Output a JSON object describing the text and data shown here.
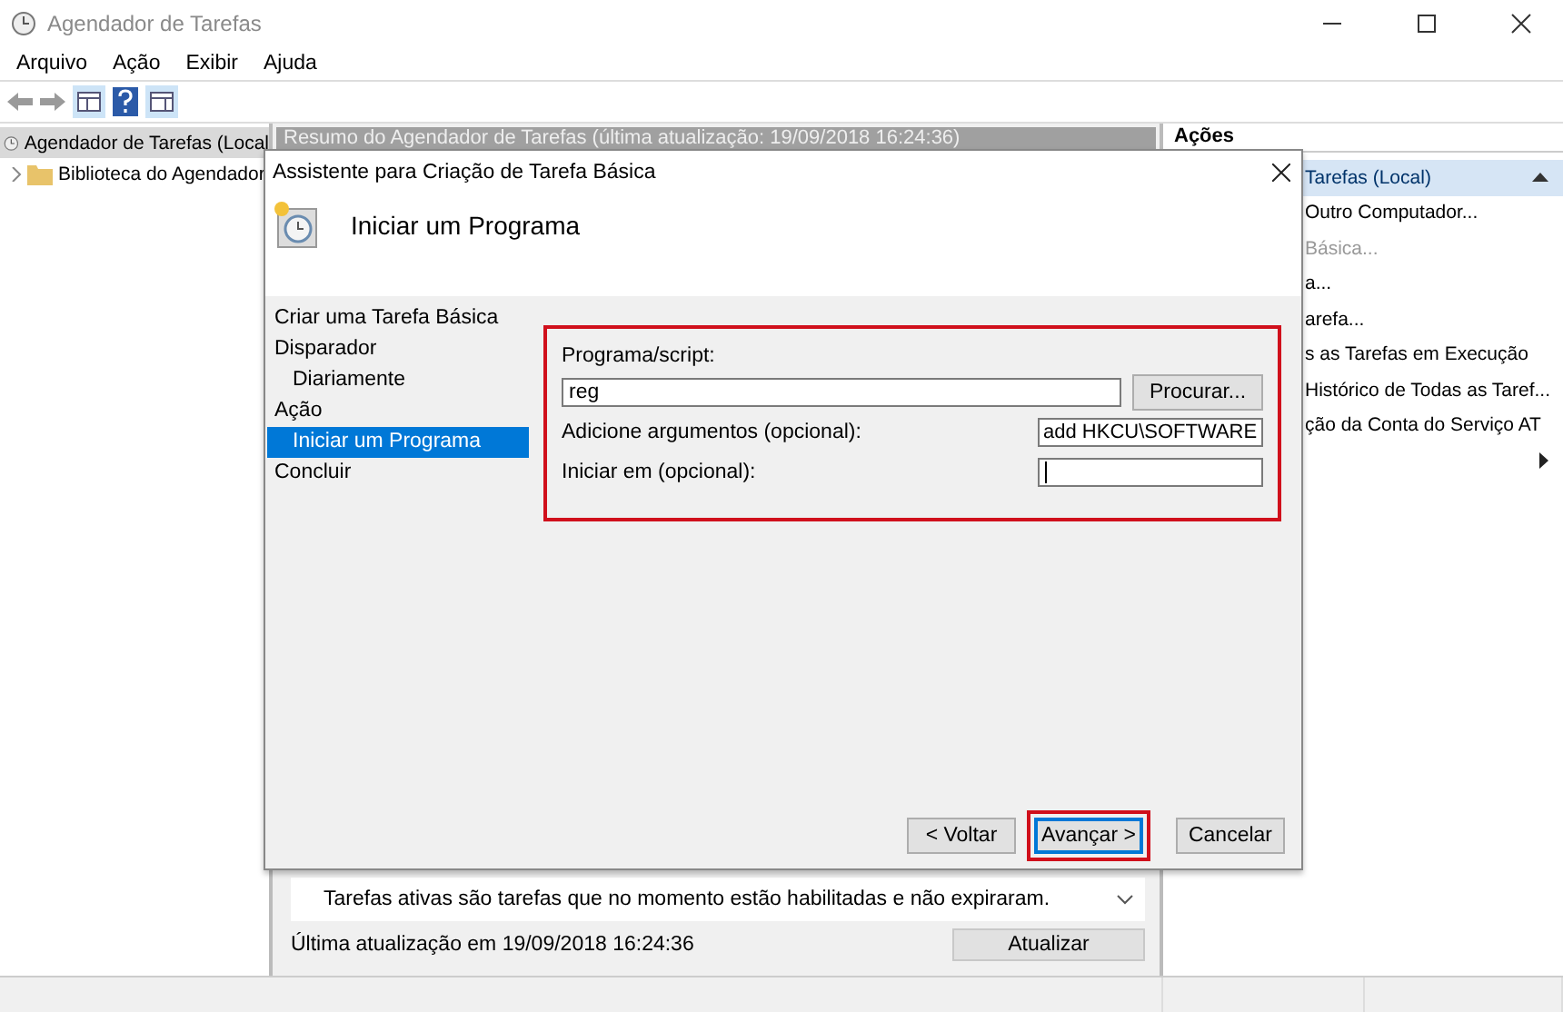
{
  "window": {
    "title": "Agendador de Tarefas"
  },
  "menu": [
    "Arquivo",
    "Ação",
    "Exibir",
    "Ajuda"
  ],
  "tree": [
    {
      "label": "Agendador de Tarefas (Local",
      "selected": true,
      "children": [
        {
          "label": "Biblioteca do Agendador",
          "selected": false,
          "expanded": false
        }
      ]
    }
  ],
  "summary": {
    "header": "Resumo do Agendador de Tarefas (última atualização: 19/09/2018 16:24:36)",
    "active_note": "Tarefas ativas são tarefas que no momento estão habilitadas e não expiraram.",
    "last_update": "Última atualização em 19/09/2018 16:24:36",
    "refresh_button": "Atualizar"
  },
  "actions": {
    "header": "Ações",
    "items": [
      {
        "label": "Tarefas (Local)",
        "kind": "group"
      },
      {
        "label": "Outro Computador...",
        "kind": "item",
        "disabled": false
      },
      {
        "label": "Básica...",
        "kind": "item",
        "disabled": true
      },
      {
        "label": "a...",
        "kind": "item",
        "disabled": false
      },
      {
        "label": "arefa...",
        "kind": "item",
        "disabled": false
      },
      {
        "label": "s as Tarefas em Execução",
        "kind": "item",
        "disabled": false
      },
      {
        "label": "Histórico de Todas as Taref...",
        "kind": "item",
        "disabled": false
      },
      {
        "label": "ção da Conta do Serviço AT",
        "kind": "item",
        "disabled": false
      },
      {
        "kind": "submenu"
      }
    ]
  },
  "dialog": {
    "title": "Assistente para Criação de Tarefa Básica",
    "heading": "Iniciar um Programa",
    "steps": [
      {
        "label": "Criar uma Tarefa Básica",
        "selected": false
      },
      {
        "label": "Disparador",
        "selected": false,
        "children": [
          {
            "label": "Diariamente",
            "selected": false
          }
        ]
      },
      {
        "label": "Ação",
        "selected": false,
        "children": [
          {
            "label": "Iniciar um Programa",
            "selected": true
          }
        ]
      },
      {
        "label": "Concluir",
        "selected": false
      }
    ],
    "form": {
      "highlighted": true,
      "program_label": "Programa/script:",
      "program_value": "reg",
      "browse_button": "Procurar...",
      "args_label": "Adicione argumentos (opcional):",
      "args_value": "add HKCU\\SOFTWARE",
      "start_label": "Iniciar em (opcional):",
      "start_focused": true
    },
    "buttons": [
      {
        "label": "< Voltar",
        "default": false,
        "highlighted": false
      },
      {
        "label": "Avançar >",
        "default": true,
        "highlighted": true
      },
      {
        "label": "Cancelar",
        "default": false,
        "highlighted": false
      }
    ]
  }
}
